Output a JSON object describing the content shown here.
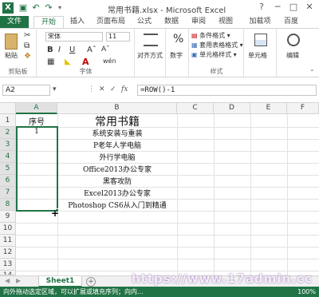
{
  "titlebar": {
    "title": "常用书籍.xlsx - Microsoft Excel",
    "logo": "X",
    "minimize": "─",
    "restore": "□",
    "close": "✕",
    "help": "?"
  },
  "tabs": [
    "文件",
    "开始",
    "插入",
    "页面布局",
    "公式",
    "数据",
    "审阅",
    "视图",
    "加载项",
    "百度"
  ],
  "ribbon": {
    "clipboard": {
      "paste": "粘贴",
      "label": "剪贴板"
    },
    "font": {
      "name": "宋体",
      "size": "11",
      "bold": "B",
      "italic": "I",
      "underline": "U",
      "label": "字体",
      "wen": "wén"
    },
    "alignment": {
      "label": "对齐方式"
    },
    "number": {
      "symbol": "%",
      "label": "数字"
    },
    "styles": {
      "conditional": "条件格式",
      "table": "套用表格格式",
      "cell_styles": "单元格样式",
      "label": "样式"
    },
    "cells": {
      "label": "单元格"
    },
    "editing": {
      "label": "编辑"
    },
    "accent": "#217346"
  },
  "formula_bar": {
    "name_box": "A2",
    "cancel": "✕",
    "enter": "✓",
    "fx": "fx",
    "formula": "=ROW()-1"
  },
  "columns": [
    "A",
    "B",
    "C",
    "D",
    "E",
    "F"
  ],
  "rows": [
    "1",
    "2",
    "3",
    "4",
    "5",
    "6",
    "7",
    "8",
    "9",
    "10",
    "11",
    "12",
    "13",
    "14"
  ],
  "cells": {
    "a1": "序号",
    "a2": "1",
    "b1": "常用书籍",
    "b2": "系统安装与重装",
    "b3": "P老年人学电脑",
    "b4": "外行学电脑",
    "b5": "Office2013办公专家",
    "b6": "黑客攻防",
    "b7": "Excel2013办公专家",
    "b8": "Photoshop CS6从入门到精通"
  },
  "sheets": {
    "active": "Sheet1",
    "add": "+",
    "prev": "◀",
    "next": "▶"
  },
  "status": {
    "message": "向外拖动选定区域，可以扩展或填充序列；向内...",
    "zoom": "100%"
  },
  "watermark": "https://www.17admin.cc"
}
